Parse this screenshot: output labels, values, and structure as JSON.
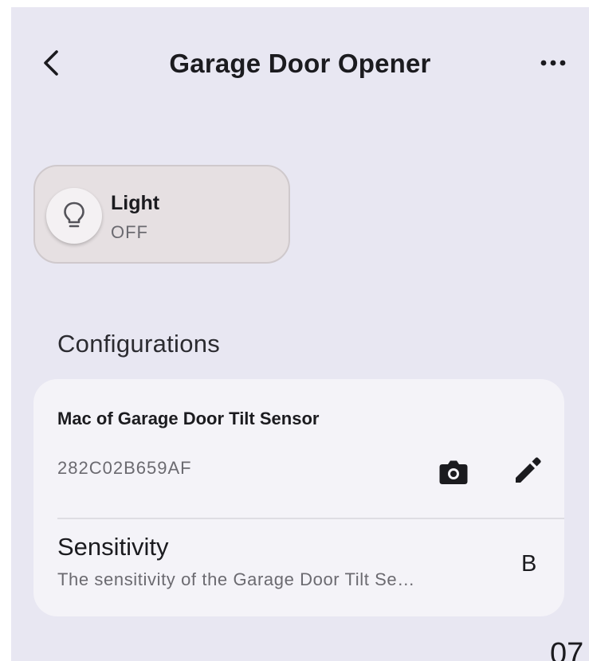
{
  "header": {
    "title": "Garage Door Opener",
    "back_icon": "chevron-left-icon",
    "more_icon": "more-horizontal-icon"
  },
  "light_tile": {
    "name": "Light",
    "state": "OFF",
    "icon": "lightbulb-icon"
  },
  "configurations": {
    "section_title": "Configurations",
    "mac": {
      "label": "Mac of Garage Door Tilt Sensor",
      "value": "282C02B659AF",
      "camera_icon": "camera-icon",
      "edit_icon": "pencil-icon"
    },
    "sensitivity": {
      "title": "Sensitivity",
      "description": "The sensitivity of the Garage Door Tilt Se…",
      "value": "B"
    }
  },
  "corner_text": "07",
  "colors": {
    "background": "#e8e7f2",
    "card": "#f4f3f8",
    "tile": "#e6e0e2",
    "text_primary": "#1b1b1f",
    "text_secondary": "#6b6a70"
  }
}
